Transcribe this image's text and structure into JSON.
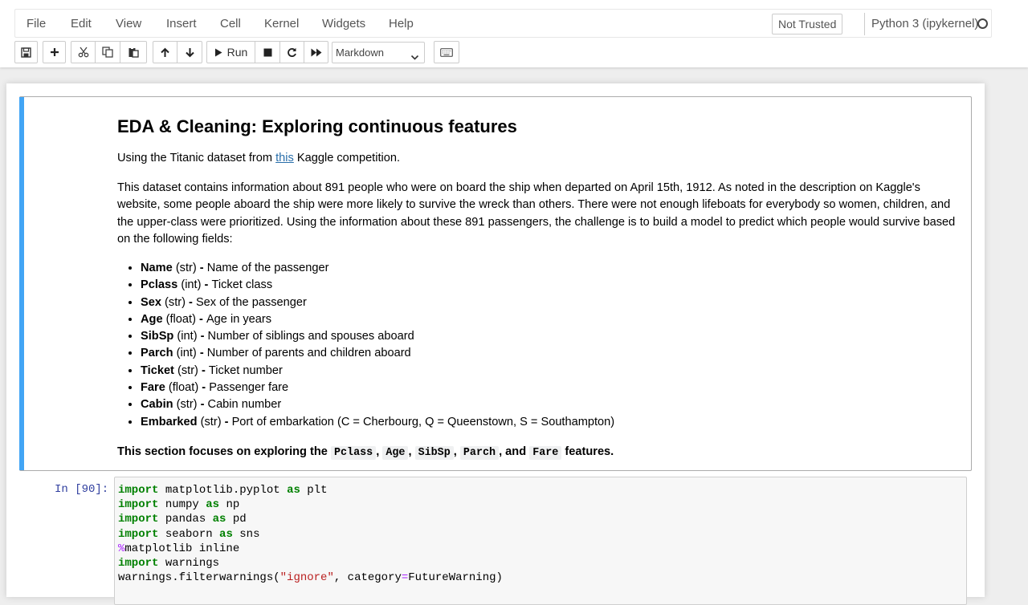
{
  "menubar": {
    "items": [
      "File",
      "Edit",
      "View",
      "Insert",
      "Cell",
      "Kernel",
      "Widgets",
      "Help"
    ],
    "trust_label": "Not Trusted",
    "kernel_name": "Python 3 (ipykernel)"
  },
  "toolbar": {
    "run_label": "Run",
    "cell_type": "Markdown",
    "icons": [
      "save-icon",
      "plus-icon",
      "cut-icon",
      "copy-icon",
      "paste-icon",
      "arrow-up-icon",
      "arrow-down-icon",
      "play-icon",
      "stop-icon",
      "restart-icon",
      "fast-forward-icon",
      "keyboard-icon"
    ]
  },
  "markdown_cell": {
    "title": "EDA & Cleaning: Exploring continuous features",
    "intro_before": "Using the Titanic dataset from ",
    "intro_link": "this",
    "intro_after": " Kaggle competition.",
    "paragraph": "This dataset contains information about 891 people who were on board the ship when departed on April 15th, 1912. As noted in the description on Kaggle's website, some people aboard the ship were more likely to survive the wreck than others. There were not enough lifeboats for everybody so women, children, and the upper-class were prioritized. Using the information about these 891 passengers, the challenge is to build a model to predict which people would survive based on the following fields:",
    "fields": [
      {
        "name": "Name",
        "type": "(str)",
        "desc": "Name of the passenger"
      },
      {
        "name": "Pclass",
        "type": "(int)",
        "desc": "Ticket class"
      },
      {
        "name": "Sex",
        "type": "(str)",
        "desc": "Sex of the passenger"
      },
      {
        "name": "Age",
        "type": "(float)",
        "desc": "Age in years"
      },
      {
        "name": "SibSp",
        "type": "(int)",
        "desc": "Number of siblings and spouses aboard"
      },
      {
        "name": "Parch",
        "type": "(int)",
        "desc": "Number of parents and children aboard"
      },
      {
        "name": "Ticket",
        "type": "(str)",
        "desc": "Ticket number"
      },
      {
        "name": "Fare",
        "type": "(float)",
        "desc": "Passenger fare"
      },
      {
        "name": "Cabin",
        "type": "(str)",
        "desc": "Cabin number"
      },
      {
        "name": "Embarked",
        "type": "(str)",
        "desc": "Port of embarkation (C = Cherbourg, Q = Queenstown, S = Southampton)"
      }
    ],
    "focus_before": "This section focuses on exploring the ",
    "focus_features": [
      "Pclass",
      "Age",
      "SibSp",
      "Parch",
      "Fare"
    ],
    "focus_sep_comma": ",",
    "focus_sep_and": ", and",
    "focus_after": " features."
  },
  "code_cell": {
    "prompt": "In [90]:",
    "lines": [
      [
        {
          "t": "import",
          "c": "kw"
        },
        {
          "t": " matplotlib.pyplot "
        },
        {
          "t": "as",
          "c": "kw"
        },
        {
          "t": " plt"
        }
      ],
      [
        {
          "t": "import",
          "c": "kw"
        },
        {
          "t": " numpy "
        },
        {
          "t": "as",
          "c": "kw"
        },
        {
          "t": " np"
        }
      ],
      [
        {
          "t": "import",
          "c": "kw"
        },
        {
          "t": " pandas "
        },
        {
          "t": "as",
          "c": "kw"
        },
        {
          "t": " pd"
        }
      ],
      [
        {
          "t": "import",
          "c": "kw"
        },
        {
          "t": " seaborn "
        },
        {
          "t": "as",
          "c": "kw"
        },
        {
          "t": " sns"
        }
      ],
      [
        {
          "t": "%",
          "c": "mg"
        },
        {
          "t": "matplotlib inline"
        }
      ],
      [
        {
          "t": "import",
          "c": "kw"
        },
        {
          "t": " warnings"
        }
      ],
      [
        {
          "t": "warnings.filterwarnings("
        },
        {
          "t": "\"ignore\"",
          "c": "st"
        },
        {
          "t": ", category"
        },
        {
          "t": "=",
          "c": "mg"
        },
        {
          "t": "FutureWarning)"
        }
      ]
    ]
  },
  "colors": {
    "selected_cell_bar": "#42a5f5",
    "link": "#296eaa",
    "keyword": "#008000",
    "prompt": "#303f9f"
  }
}
